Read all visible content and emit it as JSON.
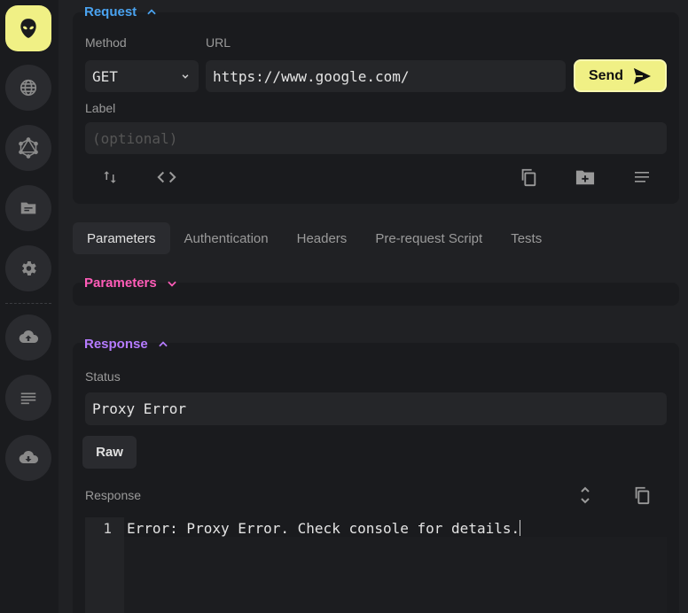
{
  "request": {
    "title": "Request",
    "method_label": "Method",
    "method_value": "GET",
    "url_label": "URL",
    "url_value": "https://www.google.com/",
    "send_label": "Send",
    "label_label": "Label",
    "label_placeholder": "(optional)"
  },
  "tabs": [
    "Parameters",
    "Authentication",
    "Headers",
    "Pre-request Script",
    "Tests"
  ],
  "parameters": {
    "title": "Parameters"
  },
  "response": {
    "title": "Response",
    "status_label": "Status",
    "status_value": "Proxy Error",
    "raw_label": "Raw",
    "response_label": "Response",
    "line_number": "1",
    "body_line": "Error: Proxy Error. Check console for details."
  },
  "colors": {
    "accent_yellow": "#f0f085",
    "request_blue": "#4aa3f0",
    "parameters_pink": "#ff5cb8",
    "response_purple": "#b57bff"
  },
  "sidebar_icons": [
    "alien-logo-icon",
    "globe-icon",
    "graphql-icon",
    "folder-icon",
    "gear-icon",
    "cloud-upload-icon",
    "list-icon",
    "cloud-download-icon"
  ]
}
